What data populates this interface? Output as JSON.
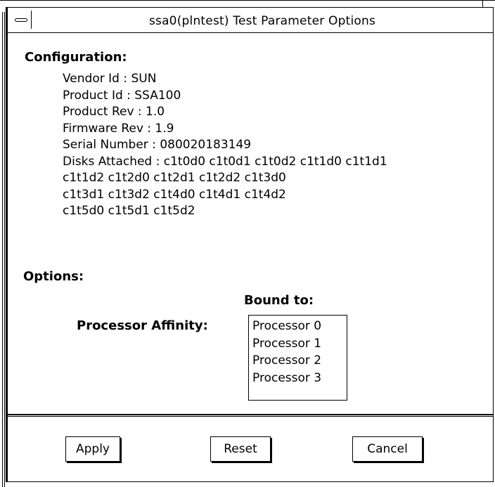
{
  "window": {
    "title": "ssa0(plntest) Test Parameter Options"
  },
  "configuration": {
    "heading": "Configuration:",
    "lines": [
      "Vendor Id : SUN",
      "Product Id : SSA100",
      "Product Rev : 1.0",
      "Firmware Rev : 1.9",
      "Serial Number : 080020183149",
      "Disks Attached : c1t0d0 c1t0d1 c1t0d2 c1t1d0 c1t1d1",
      "c1t1d2 c1t2d0 c1t2d1 c1t2d2 c1t3d0",
      "c1t3d1 c1t3d2 c1t4d0 c1t4d1 c1t4d2",
      "c1t5d0 c1t5d1 c1t5d2"
    ]
  },
  "options": {
    "heading": "Options:",
    "bound_to_label": "Bound to:",
    "processor_affinity_label": "Processor Affinity:",
    "processors": [
      "Processor 0",
      "Processor 1",
      "Processor 2",
      "Processor 3"
    ]
  },
  "buttons": {
    "apply": "Apply",
    "reset": "Reset",
    "cancel": "Cancel"
  },
  "icons": {
    "window_menu": "window-menu-icon"
  }
}
